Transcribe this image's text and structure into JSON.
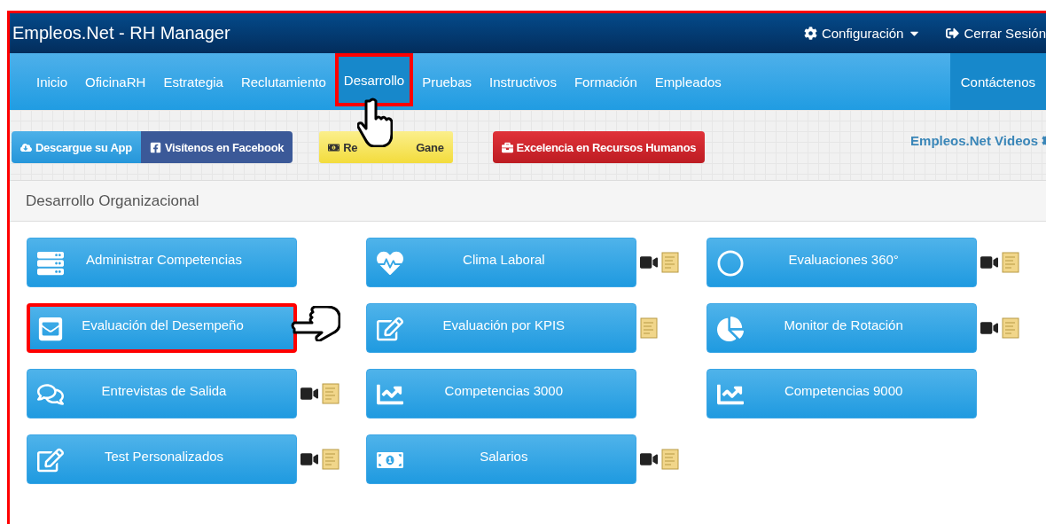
{
  "brand": "Empleos.Net - RH Manager",
  "top_links": [
    {
      "kind": "settings",
      "label": "Configuración"
    },
    {
      "kind": "logout",
      "label": "Cerrar Sesión"
    }
  ],
  "nav": [
    {
      "label": "Inicio",
      "selected": false,
      "highlighted": false
    },
    {
      "label": "OficinaRH",
      "selected": false,
      "highlighted": false
    },
    {
      "label": "Estrategia",
      "selected": false,
      "highlighted": false
    },
    {
      "label": "Reclutamiento",
      "selected": false,
      "highlighted": false
    },
    {
      "label": "Desarrollo",
      "selected": true,
      "highlighted": true
    },
    {
      "label": "Pruebas",
      "selected": false,
      "highlighted": false
    },
    {
      "label": "Instructivos",
      "selected": false,
      "highlighted": false
    },
    {
      "label": "Formación",
      "selected": false,
      "highlighted": false
    },
    {
      "label": "Empleados",
      "selected": false,
      "highlighted": false
    }
  ],
  "nav_right": {
    "label": "Contáctenos",
    "selected": true
  },
  "action_buttons": [
    {
      "kind": "app",
      "parts": [
        "Descargue su App"
      ]
    },
    {
      "kind": "facebook",
      "parts": [
        "Visítenos en Facebook"
      ]
    },
    {
      "kind": "refer",
      "parts": [
        "Re",
        "Gane"
      ]
    },
    {
      "kind": "award",
      "parts": [
        "Excelencia en Recursos Humanos"
      ]
    }
  ],
  "videos_link": "Empleos.Net Videos",
  "panel_title": "Desarrollo Organizacional",
  "columns": [
    [
      {
        "label": "Administrar Competencias",
        "kind": "list",
        "video": false,
        "doc": false,
        "highlighted": false
      },
      {
        "label": "Evaluación del Desempeño",
        "kind": "envelope",
        "video": false,
        "doc": false,
        "highlighted": true
      },
      {
        "label": "Entrevistas de Salida",
        "kind": "comments",
        "video": true,
        "doc": true,
        "highlighted": false
      },
      {
        "label": "Test Personalizados",
        "kind": "edit",
        "video": true,
        "doc": true,
        "highlighted": false
      }
    ],
    [
      {
        "label": "Clima Laboral",
        "kind": "heartbeat",
        "video": true,
        "doc": true,
        "highlighted": false
      },
      {
        "label": "Evaluación por KPIS",
        "kind": "edit",
        "video": false,
        "doc": true,
        "highlighted": false
      },
      {
        "label": "Competencias 3000",
        "kind": "chart",
        "video": false,
        "doc": false,
        "highlighted": false
      },
      {
        "label": "Salarios",
        "kind": "money",
        "video": true,
        "doc": true,
        "highlighted": false
      }
    ],
    [
      {
        "label": "Evaluaciones 360°",
        "kind": "circle",
        "video": true,
        "doc": true,
        "highlighted": false
      },
      {
        "label": "Monitor de Rotación",
        "kind": "pie",
        "video": true,
        "doc": true,
        "highlighted": false
      },
      {
        "label": "Competencias 9000",
        "kind": "chart",
        "video": false,
        "doc": false,
        "highlighted": false
      }
    ]
  ]
}
